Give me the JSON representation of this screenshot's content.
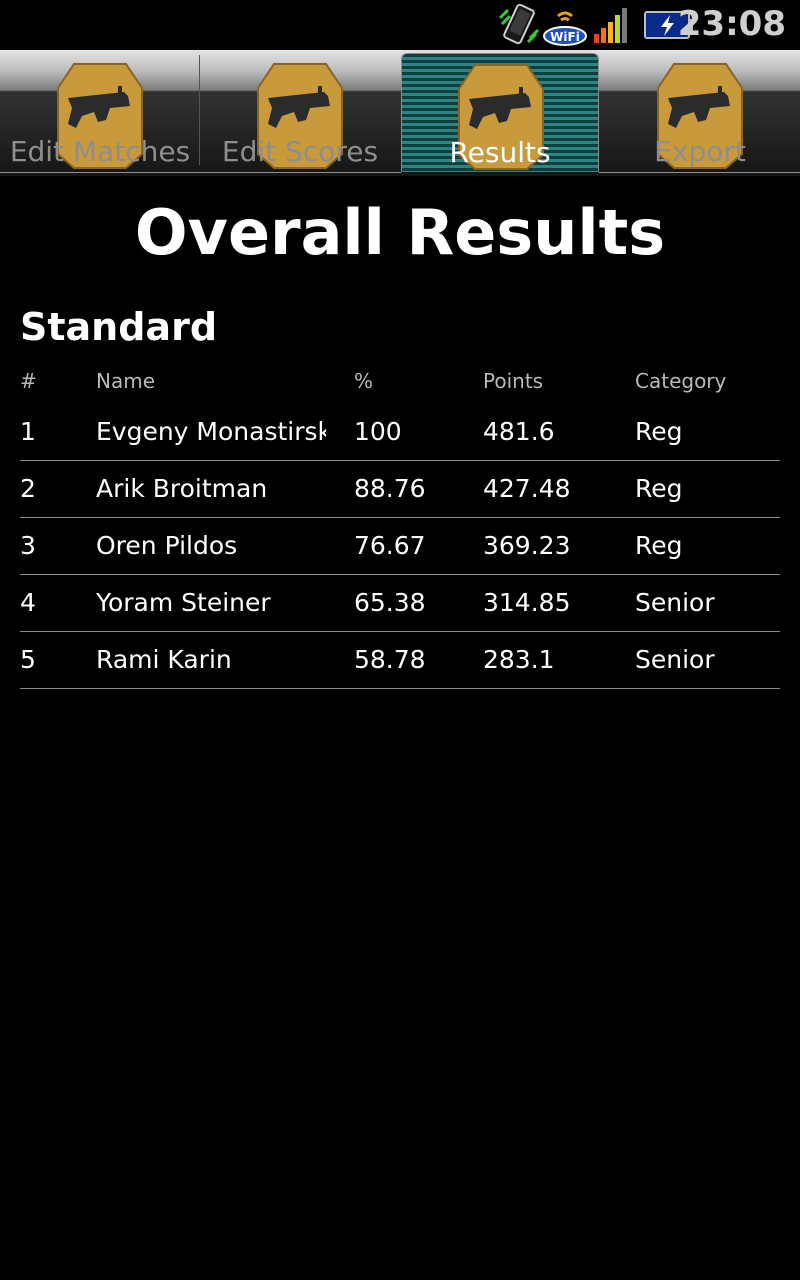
{
  "status_bar": {
    "clock": "23:08",
    "wifi_badge": "WiFi",
    "icons": [
      "sync-icon",
      "wifi-icon",
      "signal-bars-icon",
      "battery-charging-icon"
    ]
  },
  "tabs": [
    {
      "label": "Edit Matches",
      "icon": "target-pistol-icon",
      "selected": false
    },
    {
      "label": "Edit Scores",
      "icon": "target-pistol-icon",
      "selected": false
    },
    {
      "label": "Results",
      "icon": "target-pistol-icon",
      "selected": true
    },
    {
      "label": "Export",
      "icon": "target-pistol-icon",
      "selected": false
    }
  ],
  "page": {
    "title": "Overall Results",
    "section": "Standard"
  },
  "table": {
    "headers": [
      "#",
      "Name",
      "%",
      "Points",
      "Category"
    ],
    "rows": [
      {
        "rank": "1",
        "name": "Evgeny Monastirsky",
        "pct": "100",
        "points": "481.6",
        "category": "Reg"
      },
      {
        "rank": "2",
        "name": "Arik Broitman",
        "pct": "88.76",
        "points": "427.48",
        "category": "Reg"
      },
      {
        "rank": "3",
        "name": "Oren Pildos",
        "pct": "76.67",
        "points": "369.23",
        "category": "Reg"
      },
      {
        "rank": "4",
        "name": "Yoram Steiner",
        "pct": "65.38",
        "points": "314.85",
        "category": "Senior"
      },
      {
        "rank": "5",
        "name": "Rami Karin",
        "pct": "58.78",
        "points": "283.1",
        "category": "Senior"
      }
    ]
  },
  "colors": {
    "background": "#000000",
    "selected_tab": "#2f8383",
    "target_gold": "#c89a3c"
  }
}
